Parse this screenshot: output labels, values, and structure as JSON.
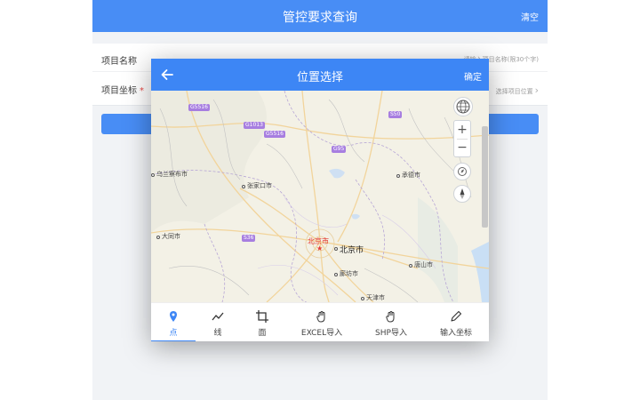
{
  "app": {
    "title": "管控要求查询",
    "clear_label": "清空"
  },
  "form": {
    "rows": [
      {
        "label": "项目名称",
        "value": "请输入项目名称(限30个字)",
        "required": ""
      },
      {
        "label": "项目坐标",
        "value": "选择项目位置",
        "required": "*"
      }
    ]
  },
  "modal": {
    "title": "位置选择",
    "confirm_label": "确定",
    "back_icon": "arrow-left-icon"
  },
  "map": {
    "places": [
      {
        "name": "乌兰察布市"
      },
      {
        "name": "张家口市"
      },
      {
        "name": "承德市"
      },
      {
        "name": "大同市"
      },
      {
        "name": "北京市"
      },
      {
        "name": "北京市"
      },
      {
        "name": "唐山市"
      },
      {
        "name": "廊坊市"
      },
      {
        "name": "天津市"
      }
    ],
    "highways": [
      "G5516",
      "G1013",
      "G5516",
      "S50",
      "G95",
      "S36"
    ],
    "controls": {
      "globe_icon": "globe-icon",
      "zoom_in": "+",
      "zoom_out": "−",
      "locate_icon": "locate-icon",
      "compass_icon": "compass-icon"
    }
  },
  "toolbar": {
    "items": [
      {
        "label": "点",
        "icon": "map-pin-icon",
        "active": true
      },
      {
        "label": "线",
        "icon": "polyline-icon",
        "active": false
      },
      {
        "label": "面",
        "icon": "crop-icon",
        "active": false
      },
      {
        "label": "EXCEL导入",
        "icon": "hand-pointer-icon",
        "active": false
      },
      {
        "label": "SHP导入",
        "icon": "hand-pointer-icon",
        "active": false
      },
      {
        "label": "输入坐标",
        "icon": "pencil-icon",
        "active": false
      }
    ]
  },
  "colors": {
    "primary": "#3d86f5",
    "required": "#e53935",
    "highway": "#a77ee0"
  }
}
